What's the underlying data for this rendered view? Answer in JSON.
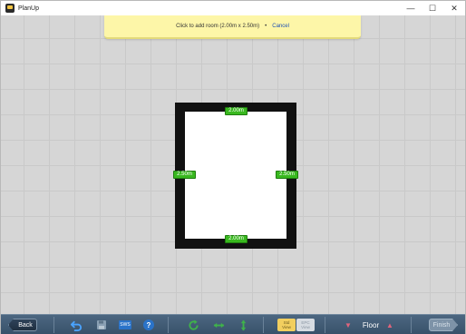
{
  "window": {
    "title": "PlanUp",
    "minimize_glyph": "—",
    "maximize_glyph": "☐",
    "close_glyph": "✕"
  },
  "prompt": {
    "text": "Click to add room (2.00m x 2.50m)",
    "separator": "•",
    "cancel": "Cancel"
  },
  "room": {
    "width_label_top": "2.00m",
    "width_label_bottom": "2.00m",
    "height_label_left": "2.50m",
    "height_label_right": "2.50m"
  },
  "toolbar": {
    "back": "Back",
    "sws": "SWS",
    "help": "?",
    "view_std": [
      "Std",
      "View"
    ],
    "view_epc": [
      "EPC",
      "View"
    ],
    "floor": "Floor",
    "finish": "Finish"
  },
  "colors": {
    "dimension_badge": "#39b81f",
    "prompt_bg": "#fdf6a8",
    "toolbar_bg": "#3f5870"
  },
  "icons": {
    "undo": "undo-icon",
    "save": "save-icon",
    "rotate": "rotate-icon",
    "flip_h": "flip-horizontal-icon",
    "flip_v": "flip-vertical-icon",
    "floor_down": "triangle-down-icon",
    "floor_up": "triangle-up-icon"
  }
}
